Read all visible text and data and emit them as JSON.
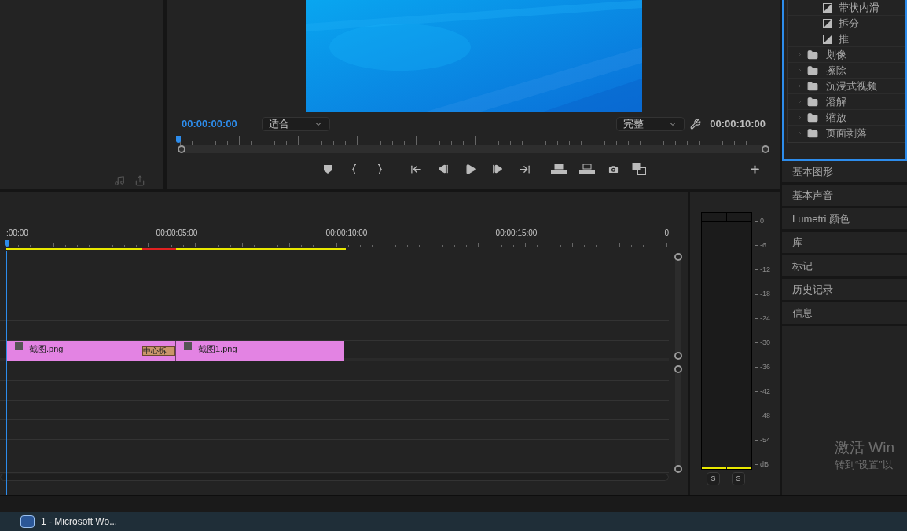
{
  "program_monitor": {
    "timecode": "00:00:00:00",
    "zoom_select": {
      "value": "适合"
    },
    "quality_select": {
      "value": "完整"
    },
    "duration": "00:00:10:00"
  },
  "effects_tree": {
    "items": [
      {
        "kind": "transition",
        "label": "带状内滑"
      },
      {
        "kind": "transition",
        "label": "拆分"
      },
      {
        "kind": "transition",
        "label": "推"
      },
      {
        "kind": "folder",
        "label": "划像",
        "expanded": false
      },
      {
        "kind": "folder",
        "label": "擦除",
        "expanded": false
      },
      {
        "kind": "folder",
        "label": "沉浸式视频",
        "expanded": false
      },
      {
        "kind": "folder",
        "label": "溶解",
        "expanded": false
      },
      {
        "kind": "folder",
        "label": "缩放",
        "expanded": false
      },
      {
        "kind": "folder",
        "label": "页面剥落",
        "expanded": false
      }
    ]
  },
  "panels": [
    {
      "label": "基本图形"
    },
    {
      "label": "基本声音"
    },
    {
      "label": "Lumetri 颜色"
    },
    {
      "label": "库"
    },
    {
      "label": "标记"
    },
    {
      "label": "历史记录"
    },
    {
      "label": "信息"
    }
  ],
  "timeline": {
    "ruler_labels": [
      ":00:00",
      "00:00:05:00",
      "00:00:10:00",
      "00:00:15:00",
      "0"
    ],
    "clips": [
      {
        "name": "截图.png"
      },
      {
        "name": "截图1.png"
      }
    ],
    "transition": "中心拆"
  },
  "audio_meter": {
    "scale": [
      "0",
      "-6",
      "-12",
      "-18",
      "-24",
      "-30",
      "-36",
      "-42",
      "-48",
      "-54",
      "dB"
    ],
    "solo_buttons": [
      "S",
      "S"
    ]
  },
  "activation": {
    "title": "激活 Win",
    "subtitle": "转到“设置”以"
  },
  "taskbar": {
    "items": [
      {
        "label": "1 - Microsoft Wo..."
      }
    ]
  }
}
